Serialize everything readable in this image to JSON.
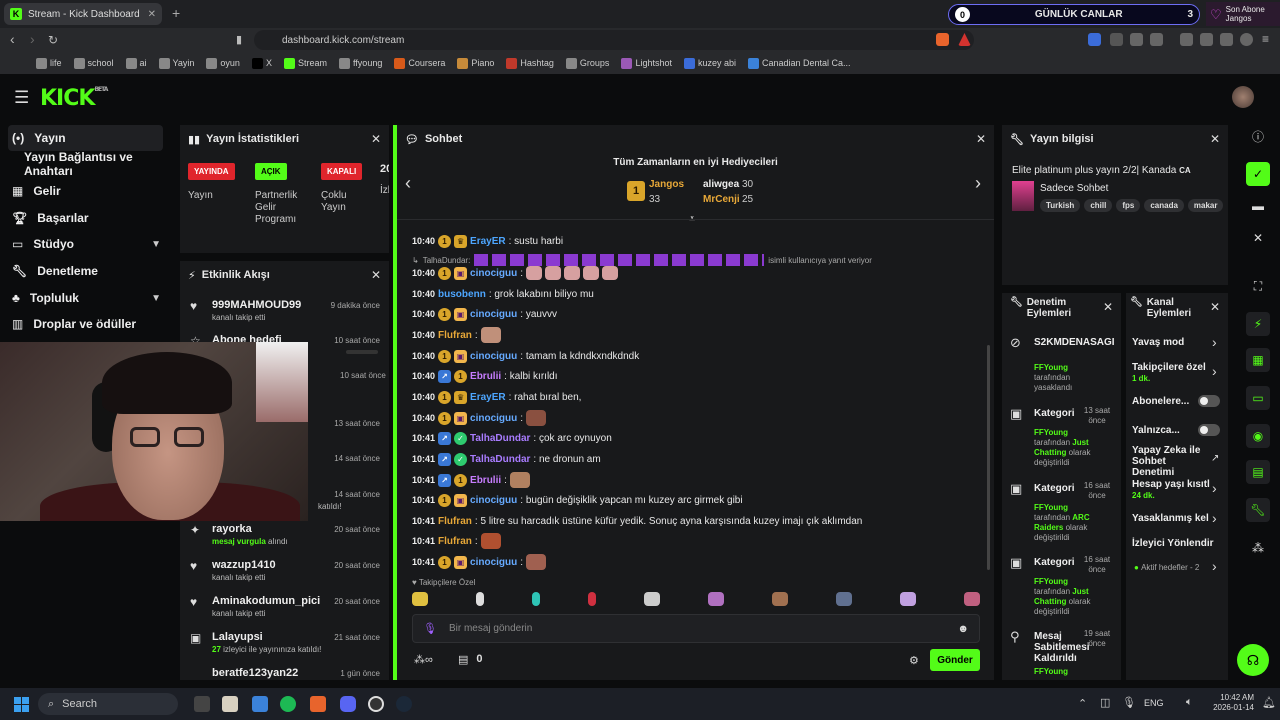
{
  "browser": {
    "tab_title": "Stream - Kick Dashboard",
    "url": "dashboard.kick.com/stream",
    "bookmarks": [
      "life",
      "school",
      "ai",
      "Yayin",
      "oyun",
      "X",
      "Stream",
      "ffyoung",
      "Coursera",
      "Piano",
      "Hashtag",
      "Groups",
      "Lightshot",
      "kuzey abi",
      "Canadian Dental Ca..."
    ]
  },
  "overlay": {
    "counter_left": "0",
    "counter_title": "GÜNLÜK CANLAR",
    "counter_right": "3",
    "son_abone_label": "Son Abone",
    "son_abone_name": "Jangos"
  },
  "nav": {
    "items": [
      "Yayın",
      "Yayın Bağlantısı ve Anahtarı",
      "Gelir",
      "Başarılar",
      "Stüdyo",
      "Denetleme",
      "Topluluk",
      "Droplar ve ödüller"
    ]
  },
  "stats": {
    "title": "Yayın İstatistikleri",
    "badges": [
      "YAYINDA",
      "AÇIK",
      "KAPALI"
    ],
    "labels": [
      "Yayın",
      "Partnerlik Gelir Programı",
      "Çoklu Yayın"
    ],
    "viewers": "20",
    "viewers_label": "İzl"
  },
  "activity": {
    "title": "Etkinlik Akışı",
    "items": [
      {
        "name": "999MAHMOUD99",
        "sub": "kanalı takip etti",
        "time": "9 dakika önce"
      },
      {
        "name": "Abone hedefi",
        "sub": "",
        "time": "10 saat önce"
      },
      {
        "name": "",
        "sub": "",
        "time": "10 saat önce"
      },
      {
        "name": "",
        "sub": "",
        "time": "13 saat önce"
      },
      {
        "name": "",
        "sub": "",
        "time": "14 saat önce"
      },
      {
        "name": "",
        "sub": "katıldı!",
        "time": "14 saat önce"
      },
      {
        "name": "rayorka",
        "sub_green": "mesaj vurgula",
        "sub": "alındı",
        "time": "20 saat önce"
      },
      {
        "name": "wazzup1410",
        "sub": "kanalı takip etti",
        "time": "20 saat önce"
      },
      {
        "name": "Aminakodumun_pici",
        "sub": "kanalı takip etti",
        "time": "20 saat önce"
      },
      {
        "name": "Lalayupsi",
        "sub_green": "27",
        "sub": "izleyici ile yayınınıza katıldı!",
        "time": "21 saat önce"
      },
      {
        "name": "beratfe123yan22",
        "sub": "",
        "time": "1 gün önce"
      }
    ]
  },
  "chat": {
    "title": "Sohbet",
    "gifters_title": "Tüm Zamanların en iyi Hediyecileri",
    "gifters": [
      {
        "name": "Jangos",
        "count": "33"
      },
      {
        "name": "aliwgea",
        "count": "30"
      },
      {
        "name": "MrCenji",
        "count": "25"
      }
    ],
    "reply_line": "TalhaDundar:",
    "reply_suffix": "isimli kullanıcıya yanıt veriyor",
    "messages": [
      {
        "ts": "10:40",
        "user": "ErayER",
        "color": "#4da6ff",
        "text": ": sustu harbi"
      },
      {
        "ts": "10:40",
        "user": "cinociguu",
        "color": "#66aaff",
        "text": ":"
      },
      {
        "ts": "10:40",
        "user": "busobenn",
        "color": "#4da6ff",
        "text": ": grok lakabını biliyo mu"
      },
      {
        "ts": "10:40",
        "user": "Flufran",
        "color": "#e8a838",
        "text": ":"
      },
      {
        "ts": "10:40",
        "user": "cinociguu",
        "color": "#66aaff",
        "text": ": yauvvv"
      },
      {
        "ts": "10:40",
        "user": "cinociguu",
        "color": "#66aaff",
        "text": ": tamam la kdndkxndkdndk"
      },
      {
        "ts": "10:40",
        "user": "Ebrulii",
        "color": "#c77dff",
        "text": ": kalbi kırıldı"
      },
      {
        "ts": "10:40",
        "user": "ErayER",
        "color": "#4da6ff",
        "text": ": rahat bıral ben,"
      },
      {
        "ts": "10:40",
        "user": "cinociguu",
        "color": "#66aaff",
        "text": ":"
      },
      {
        "ts": "10:41",
        "user": "TalhaDundar",
        "color": "#a97cff",
        "text": ": çok arc oynuyon"
      },
      {
        "ts": "10:41",
        "user": "TalhaDundar",
        "color": "#a97cff",
        "text": ": ne dronun am"
      },
      {
        "ts": "10:41",
        "user": "Ebrulii",
        "color": "#c77dff",
        "text": ":"
      },
      {
        "ts": "10:41",
        "user": "cinociguu",
        "color": "#66aaff",
        "text": ": bugün değişiklik yapcan mı kuzey arc girmek gibi"
      },
      {
        "ts": "10:41",
        "user": "Flufran",
        "color": "#e8a838",
        "text": ": 5 litre su harcadık üstüne küfür yedik. Sonuç ayna karşısında kuzey imajı çık aklımdan"
      },
      {
        "ts": "10:41",
        "user": "Flufran",
        "color": "#e8a838",
        "text": ":"
      },
      {
        "ts": "10:41",
        "user": "cinociguu",
        "color": "#66aaff",
        "text": ":"
      }
    ],
    "followers_only": "Takipçilere Özel",
    "placeholder": "Bir mesaj gönderin",
    "points": "0",
    "send": "Gönder"
  },
  "stream_info": {
    "title": "Yayın bilgisi",
    "stream_title": "Elite platinum plus yayın 2/2| Kanada",
    "flag": "CA",
    "category": "Sadece Sohbet",
    "tags": [
      "Turkish",
      "chill",
      "fps",
      "canada",
      "makar"
    ]
  },
  "mod_actions": {
    "title": "Denetim Eylemleri",
    "items": [
      {
        "title": "S2KMDENASAGI",
        "time": "",
        "by": "FFYoung",
        "desc": "tarafından yasaklandı",
        "extra": ""
      },
      {
        "title": "Kategori",
        "time": "13 saat önce",
        "by": "FFYoung",
        "desc": "tarafından",
        "green": "Just Chatting",
        "tail": "olarak değiştirildi"
      },
      {
        "title": "Kategori",
        "time": "16 saat önce",
        "by": "FFYoung",
        "desc": "tarafından",
        "green": "ARC Raiders",
        "tail": "olarak değiştirildi"
      },
      {
        "title": "Kategori",
        "time": "16 saat önce",
        "by": "FFYoung",
        "desc": "tarafından",
        "green": "Just Chatting",
        "tail": "olarak değiştirildi"
      },
      {
        "title": "Mesaj Sabitlemesi Kaldırıldı",
        "time": "19 saat önce",
        "by": "FFYoung",
        "desc": "",
        "extra": ""
      }
    ]
  },
  "channel_actions": {
    "title": "Kanal Eylemleri",
    "items": [
      {
        "label": "Yavaş mod",
        "sub": ""
      },
      {
        "label": "Takipçilere özel",
        "sub": "1 dk."
      },
      {
        "label": "Abonelere...",
        "sub": ""
      },
      {
        "label": "Yalnızca...",
        "sub": ""
      },
      {
        "label": "Yapay Zeka ile Sohbet Denetimi",
        "sub": ""
      },
      {
        "label": "Hesap yaşı kısıtl",
        "sub": "24 dk."
      },
      {
        "label": "Yasaklanmış kel",
        "sub": ""
      },
      {
        "label": "İzleyici Yönlendir",
        "sub": ""
      },
      {
        "label": "Aktif hedefler - 2",
        "sub": ""
      }
    ]
  },
  "taskbar": {
    "search": "Search",
    "lang": "ENG",
    "time": "10:42 AM",
    "date": "2026-01-14"
  }
}
